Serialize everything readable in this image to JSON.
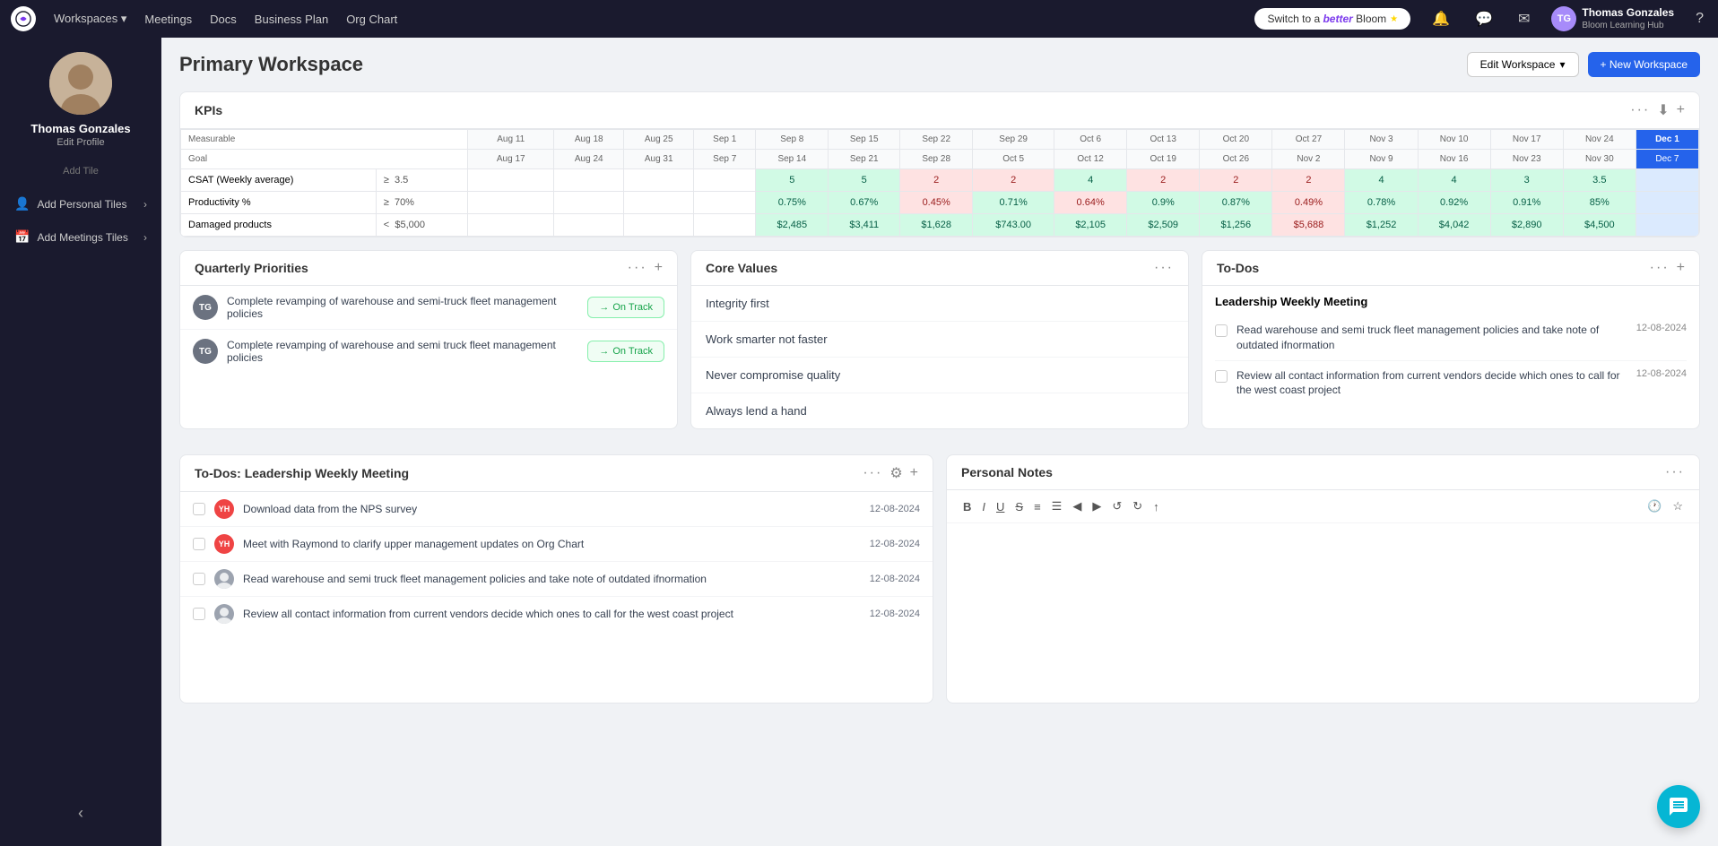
{
  "topnav": {
    "logo_alt": "Bloom Logo",
    "links": [
      "Workspaces",
      "Meetings",
      "Docs",
      "Business Plan",
      "Org Chart"
    ],
    "switch_btn": "Switch to a",
    "switch_btn_bold": "better",
    "switch_btn_suffix": "Bloom",
    "user_name": "Thomas Gonzales",
    "user_hub": "Bloom Learning Hub",
    "help_icon": "?"
  },
  "sidebar": {
    "user_name": "Thomas Gonzales",
    "edit_profile": "Edit Profile",
    "add_tile_label": "Add Tile",
    "add_personal_tiles": "Add Personal Tiles",
    "add_meetings_tiles": "Add Meetings Tiles"
  },
  "main": {
    "page_title": "Primary Workspace",
    "edit_workspace_btn": "Edit Workspace",
    "new_workspace_btn": "+ New Workspace",
    "kpi": {
      "title": "KPIs",
      "columns": [
        {
          "top": "Aug 11",
          "bot": "Aug 17"
        },
        {
          "top": "Aug 18",
          "bot": "Aug 24"
        },
        {
          "top": "Aug 25",
          "bot": "Aug 31"
        },
        {
          "top": "Sep 1",
          "bot": "Sep 7"
        },
        {
          "top": "Sep 8",
          "bot": "Sep 14"
        },
        {
          "top": "Sep 15",
          "bot": "Sep 21"
        },
        {
          "top": "Sep 22",
          "bot": "Sep 28"
        },
        {
          "top": "Sep 29",
          "bot": "Oct 5"
        },
        {
          "top": "Oct 6",
          "bot": "Oct 12"
        },
        {
          "top": "Oct 13",
          "bot": "Oct 19"
        },
        {
          "top": "Oct 20",
          "bot": "Oct 26"
        },
        {
          "top": "Oct 27",
          "bot": "Nov 2"
        },
        {
          "top": "Nov 3",
          "bot": "Nov 9"
        },
        {
          "top": "Nov 10",
          "bot": "Nov 16"
        },
        {
          "top": "Nov 17",
          "bot": "Nov 23"
        },
        {
          "top": "Nov 24",
          "bot": "Nov 30"
        },
        {
          "top": "Dec 1",
          "bot": "Dec 7",
          "highlight": true
        }
      ],
      "rows": [
        {
          "label": "CSAT (Weekly average)",
          "op": "≥",
          "goal": "3.5",
          "values": [
            "",
            "",
            "",
            "",
            "5",
            "5",
            "2",
            "2",
            "4",
            "2",
            "2",
            "2",
            "4",
            "4",
            "3",
            "3.5",
            ""
          ],
          "type": "number",
          "colors": [
            "",
            "",
            "",
            "",
            "green",
            "green",
            "red",
            "red",
            "green",
            "red",
            "red",
            "red",
            "green",
            "green",
            "green",
            "green",
            ""
          ]
        },
        {
          "label": "Productivity %",
          "op": "≥",
          "goal": "70%",
          "values": [
            "",
            "",
            "",
            "",
            "0.75%",
            "0.67%",
            "0.45%",
            "0.71%",
            "0.64%",
            "0.9%",
            "0.87%",
            "0.49%",
            "0.78%",
            "0.92%",
            "0.91%",
            "85%",
            ""
          ],
          "type": "percent",
          "colors": [
            "",
            "",
            "",
            "",
            "green",
            "green",
            "red",
            "green",
            "red",
            "green",
            "green",
            "red",
            "green",
            "green",
            "green",
            "green",
            ""
          ]
        },
        {
          "label": "Damaged products",
          "op": "<",
          "goal": "$5,000",
          "values": [
            "",
            "",
            "",
            "",
            "$2,485",
            "$3,411",
            "$1,628",
            "$743.00",
            "$2,105",
            "$2,509",
            "$1,256",
            "$5,688",
            "$1,252",
            "$4,042",
            "$2,890",
            "$4,500",
            ""
          ],
          "type": "currency",
          "colors": [
            "",
            "",
            "",
            "",
            "green",
            "green",
            "green",
            "green",
            "green",
            "green",
            "green",
            "red",
            "green",
            "green",
            "green",
            "green",
            ""
          ]
        }
      ]
    },
    "quarterly_priorities": {
      "title": "Quarterly Priorities",
      "items": [
        {
          "text": "Complete revamping of warehouse and semi-truck fleet management policies",
          "status": "On Track"
        },
        {
          "text": "Complete revamping of warehouse and semi truck fleet management policies",
          "status": "On Track"
        }
      ]
    },
    "core_values": {
      "title": "Core Values",
      "items": [
        "Integrity first",
        "Work smarter not faster",
        "Never compromise quality",
        "Always lend a hand"
      ]
    },
    "todos_main": {
      "title": "To-Dos",
      "group_title": "Leadership Weekly Meeting",
      "items": [
        {
          "text": "Read warehouse and semi truck fleet management policies and take note of outdated ifnormation",
          "date": "12-08-2024"
        },
        {
          "text": "Review all contact information from current vendors decide which ones to call for the west coast project",
          "date": "12-08-2024"
        }
      ]
    },
    "todos_meeting": {
      "title": "To-Dos: Leadership Weekly Meeting",
      "items": [
        {
          "initials": "YH",
          "color": "#ef4444",
          "text": "Download data from the NPS survey",
          "date": "12-08-2024"
        },
        {
          "initials": "YH",
          "color": "#ef4444",
          "text": "Meet with Raymond to clarify upper management updates on Org Chart",
          "date": "12-08-2024"
        },
        {
          "initials": "",
          "color": "#888",
          "text": "Read warehouse and semi truck fleet management policies and take note of outdated ifnormation",
          "date": "12-08-2024"
        },
        {
          "initials": "",
          "color": "#888",
          "text": "Review all contact information from current vendors decide which ones to call for the west coast project",
          "date": "12-08-2024"
        }
      ]
    },
    "personal_notes": {
      "title": "Personal Notes",
      "toolbar": [
        "B",
        "I",
        "U",
        "S",
        "ol",
        "ul",
        "◀",
        "▶",
        "↺",
        "↻",
        "↑"
      ],
      "placeholder": ""
    }
  }
}
